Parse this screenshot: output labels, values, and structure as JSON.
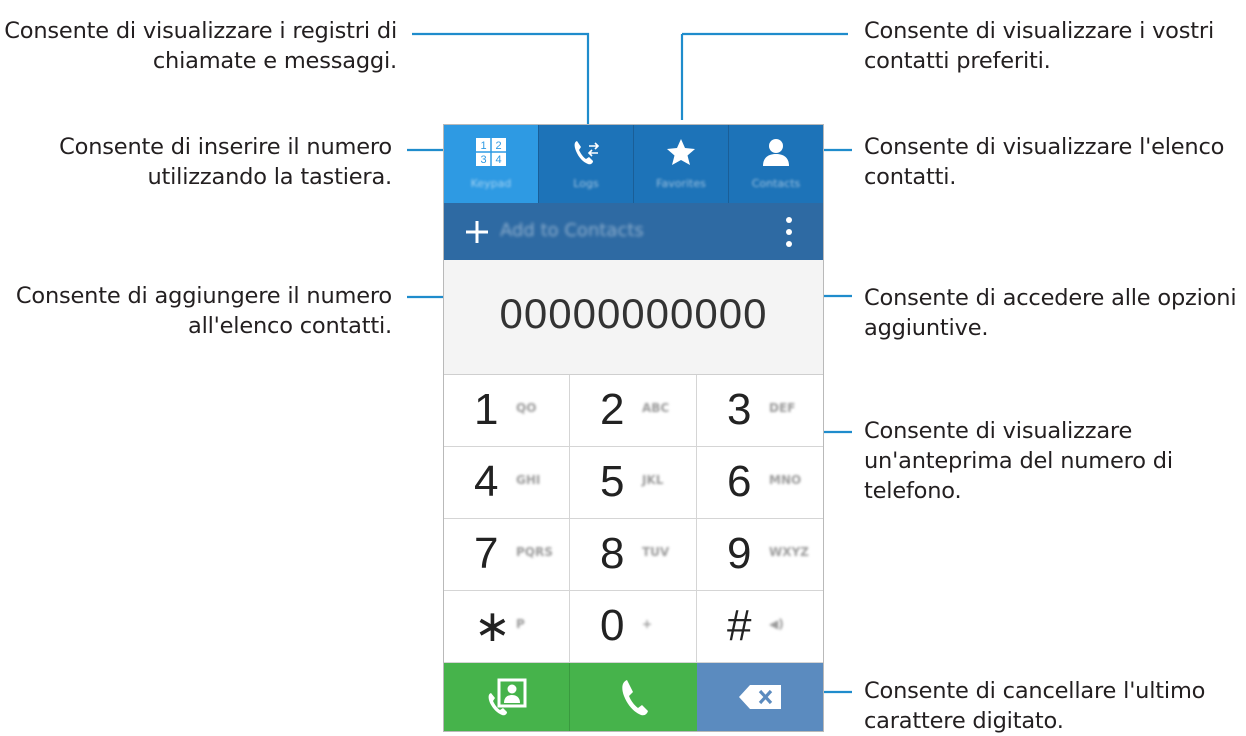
{
  "callouts": {
    "logs": "Consente di visualizzare i registri di chiamate e messaggi.",
    "keypad": "Consente di inserire il numero utilizzando la tastiera.",
    "add_contact": "Consente di aggiungere il numero all'elenco contatti.",
    "favorites": "Consente di visualizzare i vostri contatti preferiti.",
    "contacts": "Consente di visualizzare l'elenco contatti.",
    "more_options": "Consente di accedere alle opzioni aggiuntive.",
    "number_preview": "Consente di visualizzare un'anteprima del numero di telefono.",
    "delete": "Consente di cancellare l'ultimo carattere digitato."
  },
  "callout_lines": {
    "logs": [
      "Consente di visualizzare i registri di",
      "chiamate e messaggi."
    ],
    "keypad": [
      "Consente di inserire il numero",
      "utilizzando la tastiera."
    ],
    "add_contact": [
      "Consente di aggiungere il numero",
      "all'elenco contatti."
    ],
    "favorites": [
      "Consente di visualizzare i vostri",
      "contatti preferiti."
    ],
    "contacts": [
      "Consente di visualizzare l'elenco",
      "contatti."
    ],
    "more_options": [
      "Consente di accedere alle opzioni",
      "aggiuntive."
    ],
    "number_preview": [
      "Consente di visualizzare",
      "un'anteprima del numero di",
      "telefono."
    ],
    "delete": [
      "Consente di cancellare l'ultimo",
      "carattere digitato."
    ]
  },
  "tabs": [
    {
      "label": "Keypad",
      "icon": "keypad-icon",
      "active": true
    },
    {
      "label": "Logs",
      "icon": "call-log-icon",
      "active": false
    },
    {
      "label": "Favorites",
      "icon": "star-icon",
      "active": false
    },
    {
      "label": "Contacts",
      "icon": "person-icon",
      "active": false
    }
  ],
  "action_bar": {
    "add_label": "Add to Contacts",
    "plus_icon": "plus-icon",
    "more_icon": "more-vertical-icon"
  },
  "display": {
    "number": "00000000000"
  },
  "keys": [
    {
      "digit": "1",
      "letters": "QO"
    },
    {
      "digit": "2",
      "letters": "ABC"
    },
    {
      "digit": "3",
      "letters": "DEF"
    },
    {
      "digit": "4",
      "letters": "GHI"
    },
    {
      "digit": "5",
      "letters": "JKL"
    },
    {
      "digit": "6",
      "letters": "MNO"
    },
    {
      "digit": "7",
      "letters": "PQRS"
    },
    {
      "digit": "8",
      "letters": "TUV"
    },
    {
      "digit": "9",
      "letters": "WXYZ"
    },
    {
      "digit": "∗",
      "letters": "P"
    },
    {
      "digit": "0",
      "letters": "+"
    },
    {
      "digit": "#",
      "letters": "◀)"
    }
  ],
  "bottom_buttons": {
    "video_icon": "video-call-icon",
    "call_icon": "phone-icon",
    "delete_icon": "backspace-icon"
  },
  "colors": {
    "tab_bar": "#1d73b8",
    "tab_active": "#2e9ae3",
    "action_bar": "#2e6aa3",
    "leader": "#1f8ccc",
    "call_green": "#46b34b",
    "delete_blue": "#5b8bbf"
  }
}
